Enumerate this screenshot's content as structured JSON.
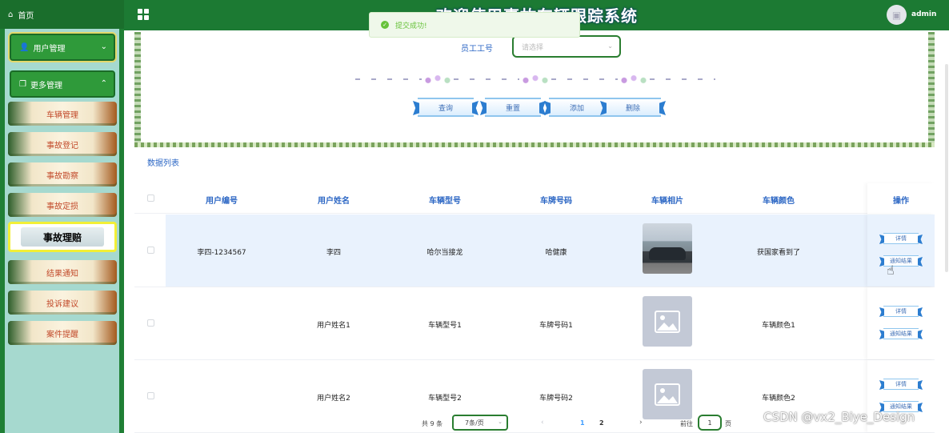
{
  "sidebar": {
    "home_label": "首页",
    "group_user": "用户管理",
    "group_more": "更多管理",
    "items": [
      {
        "label": "车辆管理",
        "active": false
      },
      {
        "label": "事故登记",
        "active": false
      },
      {
        "label": "事故勘察",
        "active": false
      },
      {
        "label": "事故定损",
        "active": false
      },
      {
        "label": "事故理赔",
        "active": true
      },
      {
        "label": "结果通知",
        "active": false
      },
      {
        "label": "投诉建议",
        "active": false
      },
      {
        "label": "案件提醒",
        "active": false
      }
    ]
  },
  "header": {
    "title": "欢迎使用事故车辆跟踪系统",
    "user": "admin"
  },
  "toast": {
    "message": "提交成功!"
  },
  "search": {
    "field_label": "员工工号",
    "placeholder": "请选择",
    "buttons": {
      "query": "查询",
      "reset": "重置",
      "add": "添加",
      "delete": "删除"
    }
  },
  "list_title": "数据列表",
  "table": {
    "headers": [
      "用户编号",
      "用户姓名",
      "车辆型号",
      "车牌号码",
      "车辆相片",
      "车辆颜色",
      "操作"
    ],
    "rows": [
      {
        "user_no": "李四-1234567",
        "user_name": "李四",
        "model": "哈尔当接龙",
        "plate": "哈健康",
        "photo": "car-photo",
        "color": "获国家看到了",
        "detail": "详情",
        "notify": "通知结果"
      },
      {
        "user_no": "",
        "user_name": "用户姓名1",
        "model": "车辆型号1",
        "plate": "车牌号码1",
        "photo": "image-placeholder",
        "color": "车辆颜色1",
        "detail": "详情",
        "notify": "通知结果"
      },
      {
        "user_no": "",
        "user_name": "用户姓名2",
        "model": "车辆型号2",
        "plate": "车牌号码2",
        "photo": "image-placeholder",
        "color": "车辆颜色2",
        "detail": "详情",
        "notify": "通知结果"
      }
    ]
  },
  "pagination": {
    "total": "共 9 条",
    "page_size": "7条/页",
    "pages": [
      "1",
      "2"
    ],
    "current": "1",
    "goto_label": "前往",
    "goto_value": "1",
    "page_suffix": "页"
  },
  "watermark": "CSDN @vx2_Biye_Design",
  "colors": {
    "header_green": "#1c7a33",
    "accent_blue": "#2b66c4",
    "success": "#67c23a",
    "active_border": "#f2ef36"
  }
}
